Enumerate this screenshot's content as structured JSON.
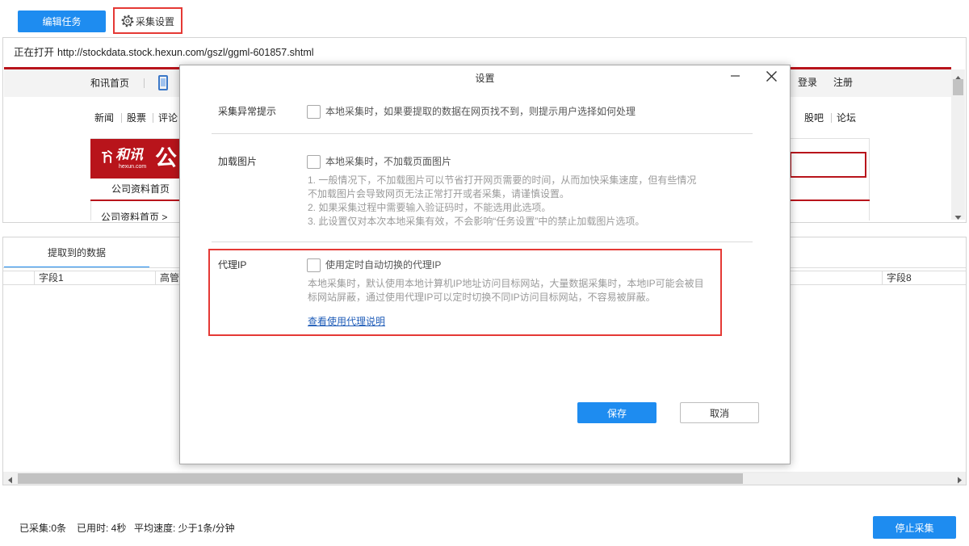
{
  "colors": {
    "accent": "#1e8cf0",
    "highlight": "#e53935",
    "brand_red": "#b8141b",
    "link": "#1f5cb8"
  },
  "toolbar": {
    "edit_task_label": "编辑任务",
    "collect_settings_label": "采集设置",
    "collect_settings_icon": "gear-icon"
  },
  "browser": {
    "status_prefix": "正在打开",
    "url": "http://stockdata.stock.hexun.com/gszl/ggml-601857.shtml",
    "webpage": {
      "home_link": "和讯首页",
      "app_icon": "mobile-phone-icon",
      "login_link": "登录",
      "register_link": "注册",
      "channels_left": [
        "新闻",
        "股票",
        "评论"
      ],
      "channels_right": [
        "股吧",
        "论坛"
      ],
      "logo": {
        "name": "和讯",
        "domain": "hexun.com",
        "title_char": "公"
      },
      "section_tab": "公司资料首页",
      "breadcrumb": "公司资料首页 >"
    }
  },
  "data_panel": {
    "tab_label": "提取到的数据",
    "columns": [
      "字段1",
      "高管",
      "字段8"
    ]
  },
  "status_bar": {
    "collected": "已采集:0条",
    "elapsed": "已用时: 4秒",
    "avg_speed": "平均速度: 少于1条/分钟",
    "stop_label": "停止采集"
  },
  "dialog": {
    "title": "设置",
    "sections": [
      {
        "label": "采集异常提示",
        "option": "本地采集时，如果要提取的数据在网页找不到，则提示用户选择如何处理",
        "checked": false
      },
      {
        "label": "加载图片",
        "option": "本地采集时，不加载页面图片",
        "checked": false,
        "hint_lines": [
          "1. 一般情况下，不加载图片可以节省打开网页需要的时间，从而加快采集速度，但有些情况",
          "不加载图片会导致网页无法正常打开或者采集，请谨慎设置。",
          "2. 如果采集过程中需要输入验证码时，不能选用此选项。",
          "3. 此设置仅对本次本地采集有效，不会影响“任务设置”中的禁止加载图片选项。"
        ]
      },
      {
        "label": "代理IP",
        "option": "使用定时自动切换的代理IP",
        "checked": false,
        "hint_lines": [
          "本地采集时，默认使用本地计算机IP地址访问目标网站，大量数据采集时，本地IP可能会被目",
          "标网站屏蔽，通过使用代理IP可以定时切换不同IP访问目标网站，不容易被屏蔽。"
        ],
        "link": "查看使用代理说明"
      }
    ],
    "save_label": "保存",
    "cancel_label": "取消"
  }
}
